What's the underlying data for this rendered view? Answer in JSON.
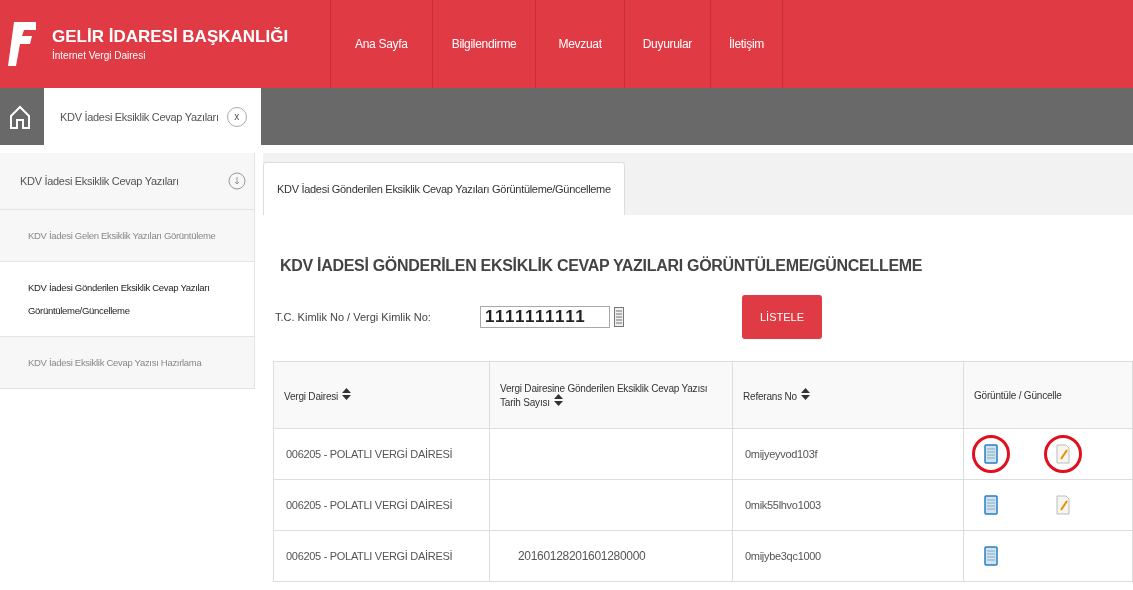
{
  "header": {
    "title": "GELİR İDARESİ BAŞKANLIĞI",
    "subtitle": "İnternet Vergi Dairesi",
    "nav": [
      {
        "label": "Ana Sayfa"
      },
      {
        "label": "Bilgilendirme"
      },
      {
        "label": "Mevzuat"
      },
      {
        "label": "Duyurular"
      },
      {
        "label": "İletişim"
      }
    ]
  },
  "tab_bar": {
    "tabs": [
      {
        "label": "KDV İadesi Eksiklik Cevap Yazıları",
        "close": "x"
      }
    ]
  },
  "sidebar": {
    "title": "KDV İadesi Eksiklik Cevap Yazıları",
    "items": [
      {
        "label": "KDV İadesi Gelen Eksiklik Yazıları Görüntüleme",
        "selected": false
      },
      {
        "label": "KDV İadesi Gönderilen Eksiklik Cevap Yazıları Görüntüleme/Güncelleme",
        "selected": true
      },
      {
        "label": "KDV İadesi Eksiklik Cevap Yazısı Hazırlama",
        "selected": false
      }
    ]
  },
  "content_tabs": [
    {
      "label": "KDV İadesi Gönderilen Eksiklik Cevap Yazıları Görüntüleme/Güncelleme",
      "selected": true
    }
  ],
  "page_title": "KDV İADESİ GÖNDERİLEN EKSİKLİK CEVAP YAZILARI GÖRÜNTÜLEME/GÜNCELLEME",
  "form": {
    "label": "T.C. Kimlik No / Vergi Kimlik No:",
    "value": "1111111111",
    "button": "LİSTELE"
  },
  "table": {
    "columns": [
      {
        "label": "Vergi Dairesi",
        "sortable": true
      },
      {
        "label": "Vergi Dairesine Gönderilen Eksiklik Cevap Yazısı Tarih Sayısı",
        "sortable": true
      },
      {
        "label": "Referans No",
        "sortable": true
      },
      {
        "label": "Görüntüle / Güncelle",
        "sortable": false
      }
    ],
    "rows": [
      {
        "office": "006205 - POLATLI VERGİ DAİRESİ",
        "date_number": "",
        "reference": "0mijyeyvod103f",
        "editable": true,
        "highlighted": true
      },
      {
        "office": "006205 - POLATLI VERGİ DAİRESİ",
        "date_number": "",
        "reference": "0mik55lhvo1003",
        "editable": true,
        "highlighted": false
      },
      {
        "office": "006205 - POLATLI VERGİ DAİRESİ",
        "date_number": "20160128201601280000",
        "reference": "0mijybe3qc1000",
        "editable": false,
        "highlighted": false
      }
    ]
  }
}
